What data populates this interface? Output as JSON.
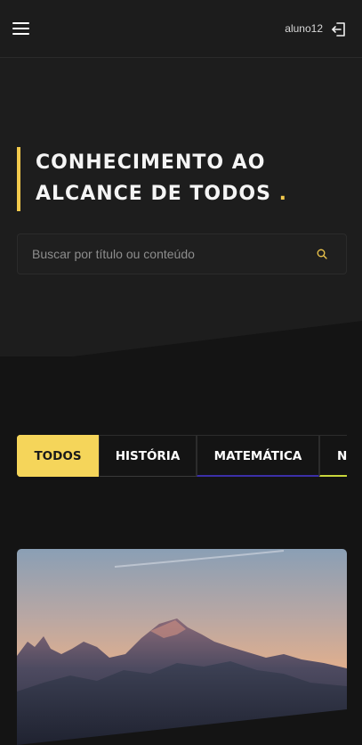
{
  "header": {
    "menu_icon": "hamburger-menu-icon",
    "username": "aluno12",
    "logout_icon": "logout-icon"
  },
  "hero": {
    "title_line1": "CONHECIMENTO AO",
    "title_line2": "ALCANCE DE TODOS",
    "title_dot": ".",
    "accent_color": "#f2c94c"
  },
  "search": {
    "placeholder": "Buscar por título ou conteúdo",
    "icon": "search-icon"
  },
  "tabs": [
    {
      "label": "TODOS",
      "active": true
    },
    {
      "label": "HISTÓRIA"
    },
    {
      "label": "MATEMÁTICA"
    },
    {
      "label": "N"
    }
  ],
  "card": {
    "image": "mountain-landscape"
  }
}
